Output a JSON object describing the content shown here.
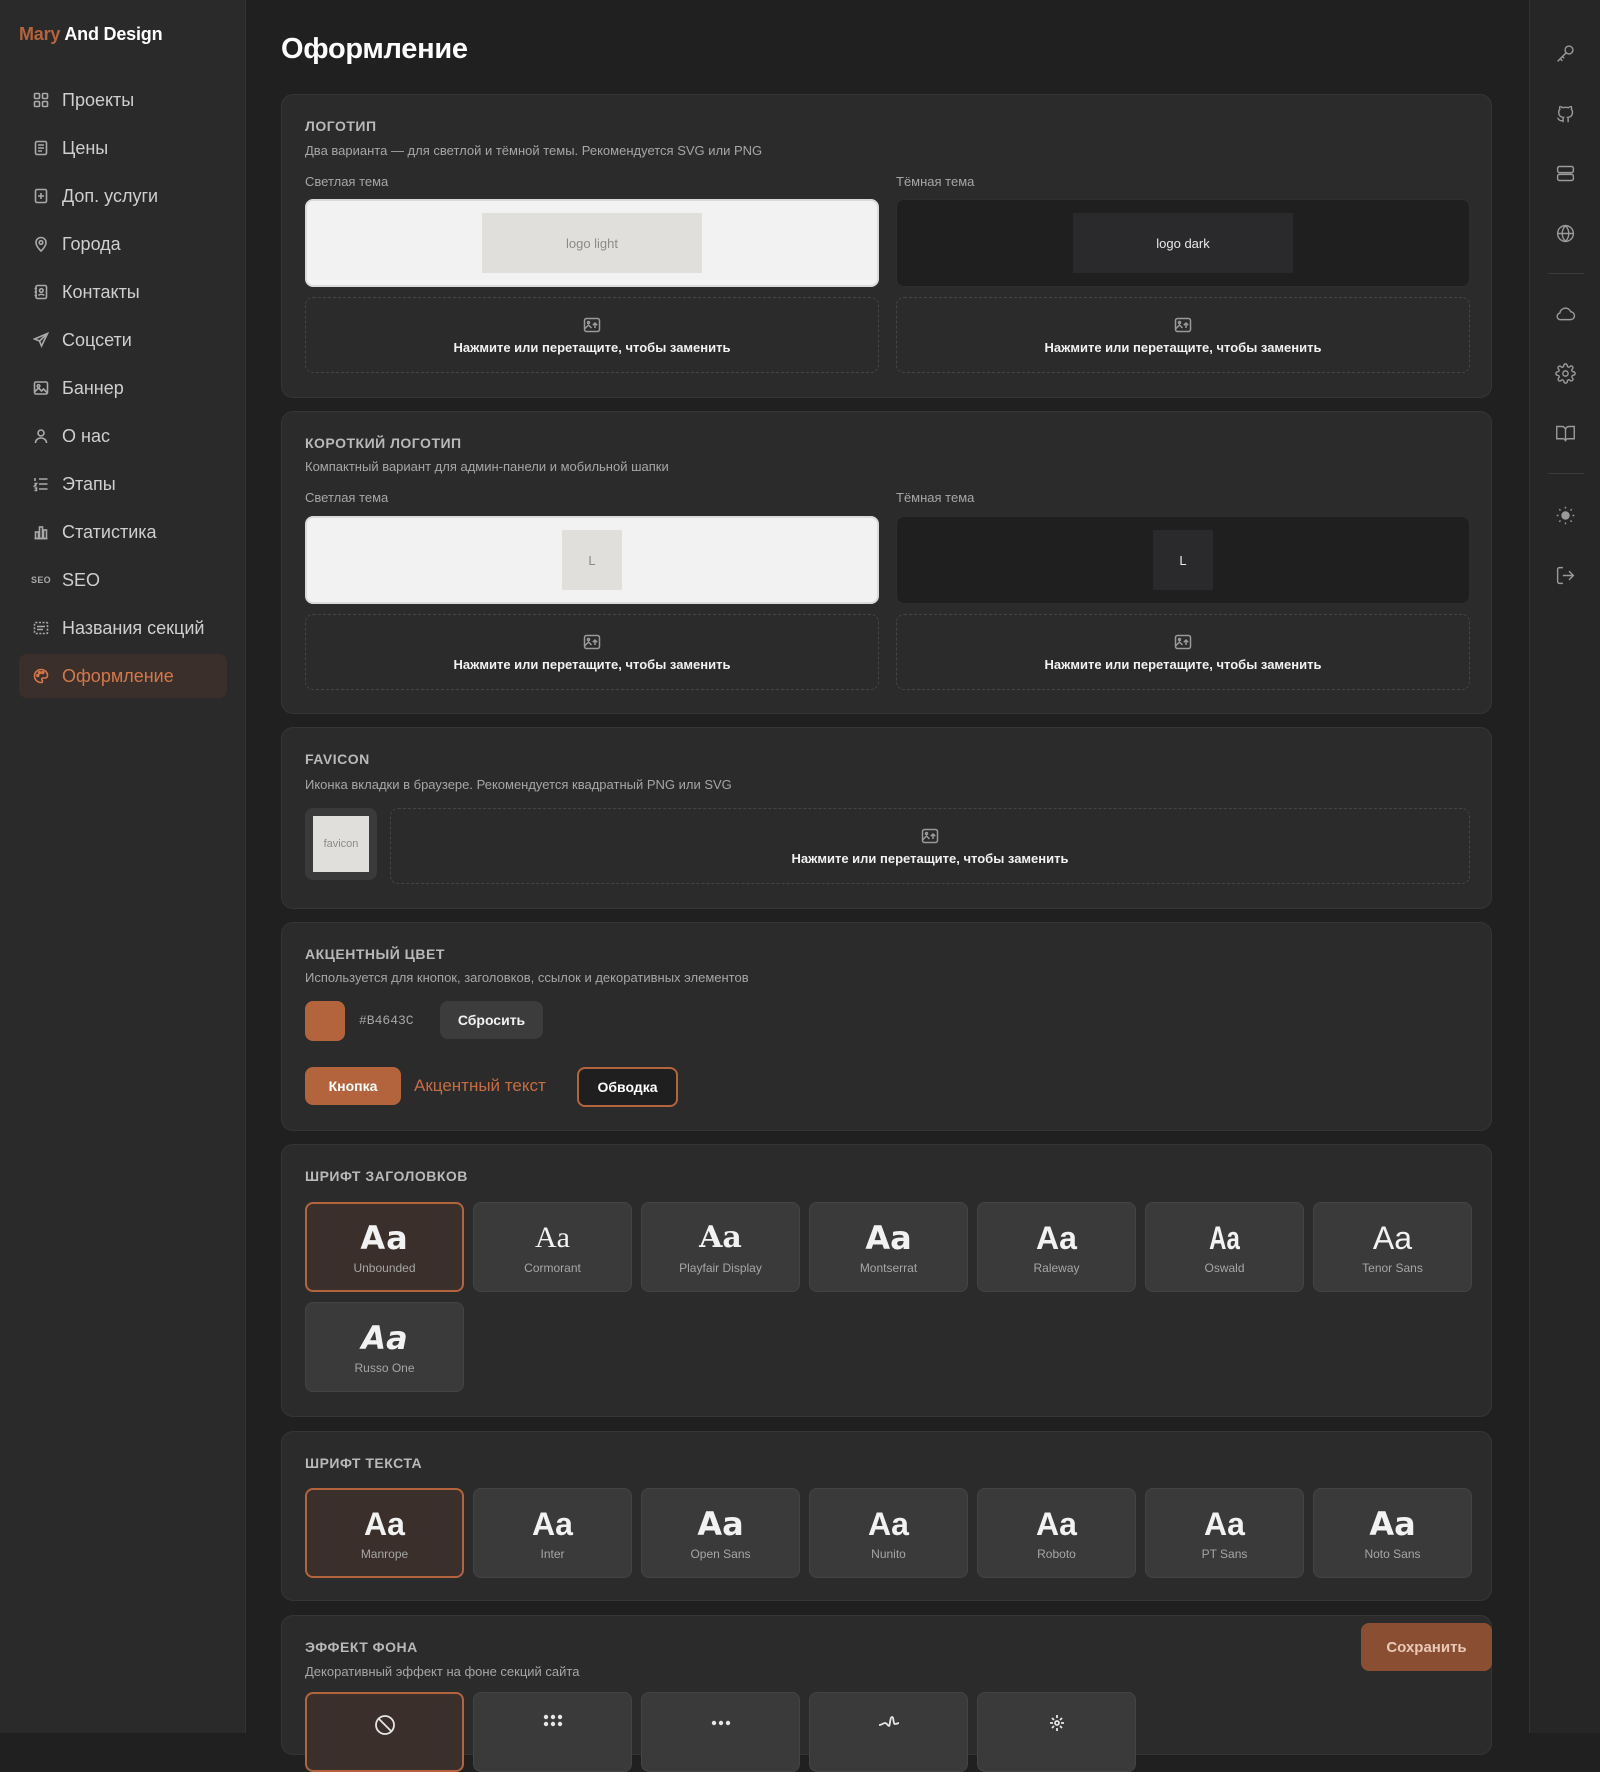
{
  "brand": {
    "part1": "Mary",
    "part2": " And Design"
  },
  "nav": [
    {
      "label": "Проекты",
      "icon": "grid-icon"
    },
    {
      "label": "Цены",
      "icon": "receipt-icon"
    },
    {
      "label": "Доп. услуги",
      "icon": "receipt-plus-icon"
    },
    {
      "label": "Города",
      "icon": "map-pin-icon"
    },
    {
      "label": "Контакты",
      "icon": "contact-book-icon"
    },
    {
      "label": "Соцсети",
      "icon": "send-icon"
    },
    {
      "label": "Баннер",
      "icon": "image-icon"
    },
    {
      "label": "О нас",
      "icon": "user-icon"
    },
    {
      "label": "Этапы",
      "icon": "list-ordered-icon"
    },
    {
      "label": "Статистика",
      "icon": "bar-chart-icon"
    },
    {
      "label": "SEO",
      "icon": "seo-icon",
      "icon_text": "SEO"
    },
    {
      "label": "Названия секций",
      "icon": "sections-icon"
    },
    {
      "label": "Оформление",
      "icon": "palette-icon",
      "active": true
    }
  ],
  "rail_icons": [
    "key-icon",
    "github-icon",
    "server-icon",
    "globe-icon",
    "cloud-icon",
    "settings-icon",
    "book-icon",
    "sun-icon",
    "logout-icon"
  ],
  "page_title": "Оформление",
  "logo": {
    "title": "Логотип",
    "desc": "Два варианта — для светлой и тёмной темы. Рекомендуется SVG или PNG",
    "light_label": "Светлая тема",
    "dark_label": "Тёмная тема",
    "light_placeholder": "logo light",
    "dark_placeholder": "logo dark"
  },
  "short_logo": {
    "title": "Короткий логотип",
    "desc": "Компактный вариант для админ-панели и мобильной шапки",
    "light_label": "Светлая тема",
    "dark_label": "Тёмная тема",
    "light_placeholder": "L",
    "dark_placeholder": "L"
  },
  "favicon": {
    "title": "Favicon",
    "desc": "Иконка вкладки в браузере. Рекомендуется квадратный PNG или SVG",
    "placeholder": "favicon"
  },
  "upload_text": "Нажмите или перетащите, чтобы заменить",
  "accent": {
    "title": "Акцентный цвет",
    "desc": "Используется для кнопок, заголовков, ссылок и декоративных элементов",
    "color": "#B4643C",
    "hex_label": "#B4643C",
    "reset_label": "Сбросить",
    "button_label": "Кнопка",
    "text_label": "Акцентный текст",
    "outline_label": "Обводка"
  },
  "heading_fonts": {
    "title": "Шрифт заголовков",
    "selected": "Unbounded",
    "items": [
      {
        "sample": "Aa",
        "name": "Unbounded"
      },
      {
        "sample": "Aa",
        "name": "Cormorant"
      },
      {
        "sample": "Aa",
        "name": "Playfair Display"
      },
      {
        "sample": "Aa",
        "name": "Montserrat"
      },
      {
        "sample": "Aa",
        "name": "Raleway"
      },
      {
        "sample": "Aa",
        "name": "Oswald"
      },
      {
        "sample": "Aa",
        "name": "Tenor Sans"
      },
      {
        "sample": "Aa",
        "name": "Russo One"
      }
    ]
  },
  "text_fonts": {
    "title": "Шрифт текста",
    "selected": "Manrope",
    "items": [
      {
        "sample": "Aa",
        "name": "Manrope"
      },
      {
        "sample": "Aa",
        "name": "Inter"
      },
      {
        "sample": "Aa",
        "name": "Open Sans"
      },
      {
        "sample": "Aa",
        "name": "Nunito"
      },
      {
        "sample": "Aa",
        "name": "Roboto"
      },
      {
        "sample": "Aa",
        "name": "PT Sans"
      },
      {
        "sample": "Aa",
        "name": "Noto Sans"
      }
    ]
  },
  "background_effect": {
    "title": "Эффект фона",
    "desc": "Декоративный эффект на фоне секций сайта",
    "options": [
      {
        "icon": "no-effect-icon",
        "selected": true
      },
      {
        "icon": "dots-grid-icon"
      },
      {
        "icon": "dots-line-icon"
      },
      {
        "icon": "wave-icon"
      },
      {
        "icon": "sparkle-icon"
      }
    ]
  },
  "save_label": "Сохранить"
}
